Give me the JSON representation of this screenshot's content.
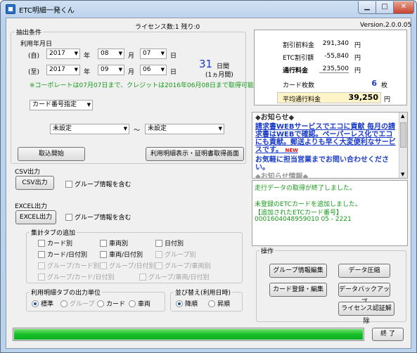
{
  "window": {
    "title": "ETC明細一発くん",
    "minimize": "▁",
    "maximize": "□",
    "close": "✕"
  },
  "header": {
    "license": "ライセンス数:1  残り:0",
    "version": "Version.2.0.0.05"
  },
  "extraction": {
    "group_title": "抽出条件",
    "date_title": "利用年月日",
    "from": {
      "label": "(自)",
      "year": "2017",
      "month": "08",
      "day": "07",
      "year_unit": "年",
      "month_unit": "月",
      "day_unit": "日"
    },
    "to": {
      "label": "(至)",
      "year": "2017",
      "month": "09",
      "day": "06",
      "year_unit": "年",
      "month_unit": "月",
      "day_unit": "日"
    },
    "days_count": "31",
    "days_unit": "日間",
    "months_note": "(1ヵ月間)",
    "notice": "※コーポレートは07月07日まで、クレジットは2016年06月08日まで取得可能です。",
    "card_spec_select": "カード番号指定",
    "range_from": "未設定",
    "range_tilde": "～",
    "range_to": "未設定"
  },
  "buttons": {
    "fetch": "取込開始",
    "statement": "利用明細表示・証明書取得画面",
    "csv_output": "CSV出力",
    "excel_output": "EXCEL出力",
    "group_edit": "グループ情報編集",
    "data_compress": "データ圧縮",
    "card_register": "カード登録・編集",
    "data_backup": "データバックアップ",
    "license_release": "ライセンス認証解除",
    "exit": "終 了"
  },
  "csv": {
    "title": "CSV出力",
    "group_info": "グループ情報を含む"
  },
  "excel": {
    "title": "EXCEL出力",
    "group_info": "グループ情報を含む"
  },
  "tabs_add": {
    "title": "集計タブの追加",
    "row1": [
      "カード別",
      "車両別",
      "日付別"
    ],
    "row2": [
      "カード/日付別",
      "車両/日付別",
      "グループ別"
    ],
    "row3": [
      "グループ/カード別",
      "グループ/日付別",
      "グループ/車両別"
    ],
    "row4": [
      "グループ/カード/日付別",
      "グループ/車両/日付別"
    ]
  },
  "statement_unit": {
    "title": "利用明細タブの出力単位",
    "options": [
      "標準",
      "グループ",
      "カード",
      "車両"
    ]
  },
  "sort": {
    "title": "並び替え(利用日時)",
    "options": [
      "降順",
      "昇順"
    ]
  },
  "operations": {
    "title": "操作"
  },
  "summary": {
    "discount_before": {
      "label": "割引前料金",
      "value": "291,340",
      "unit": "円"
    },
    "etc_discount": {
      "label": "ETC割引額",
      "value": "-55,840",
      "unit": "円"
    },
    "toll": {
      "label": "通行料金",
      "value": "235,500",
      "unit": "円"
    },
    "card_count": {
      "label": "カード枚数",
      "value": "6",
      "unit": "枚"
    },
    "avg_toll": {
      "label": "平均通行料金",
      "value": "39,250",
      "unit": "円"
    }
  },
  "news": {
    "title": "◆お知らせ◆",
    "body_line1": "請求書WEBサービスでエコに貢献 毎月の請求書はWEBで確認。ペーパーレス化でエコにも貢献。郵送よりも早く大変便利なサービスです。",
    "new_badge": "NEW",
    "body_line2": "お気軽に担当営業までお問い合わせください。",
    "more": "◆お知らせ情報◆"
  },
  "log": {
    "line1": "走行データの取得が終了しました。",
    "line2": "未登録のETCカードを追加しました。",
    "line3": "【追加されたETCカード番号】",
    "line4": "0001604048959010 05 - 2221"
  },
  "progress": {
    "value": 100
  },
  "colors": {
    "blue_text": "#1a3cc7",
    "green_text": "#159a17",
    "red_badge": "#e01010",
    "progress": "#16c02a"
  }
}
